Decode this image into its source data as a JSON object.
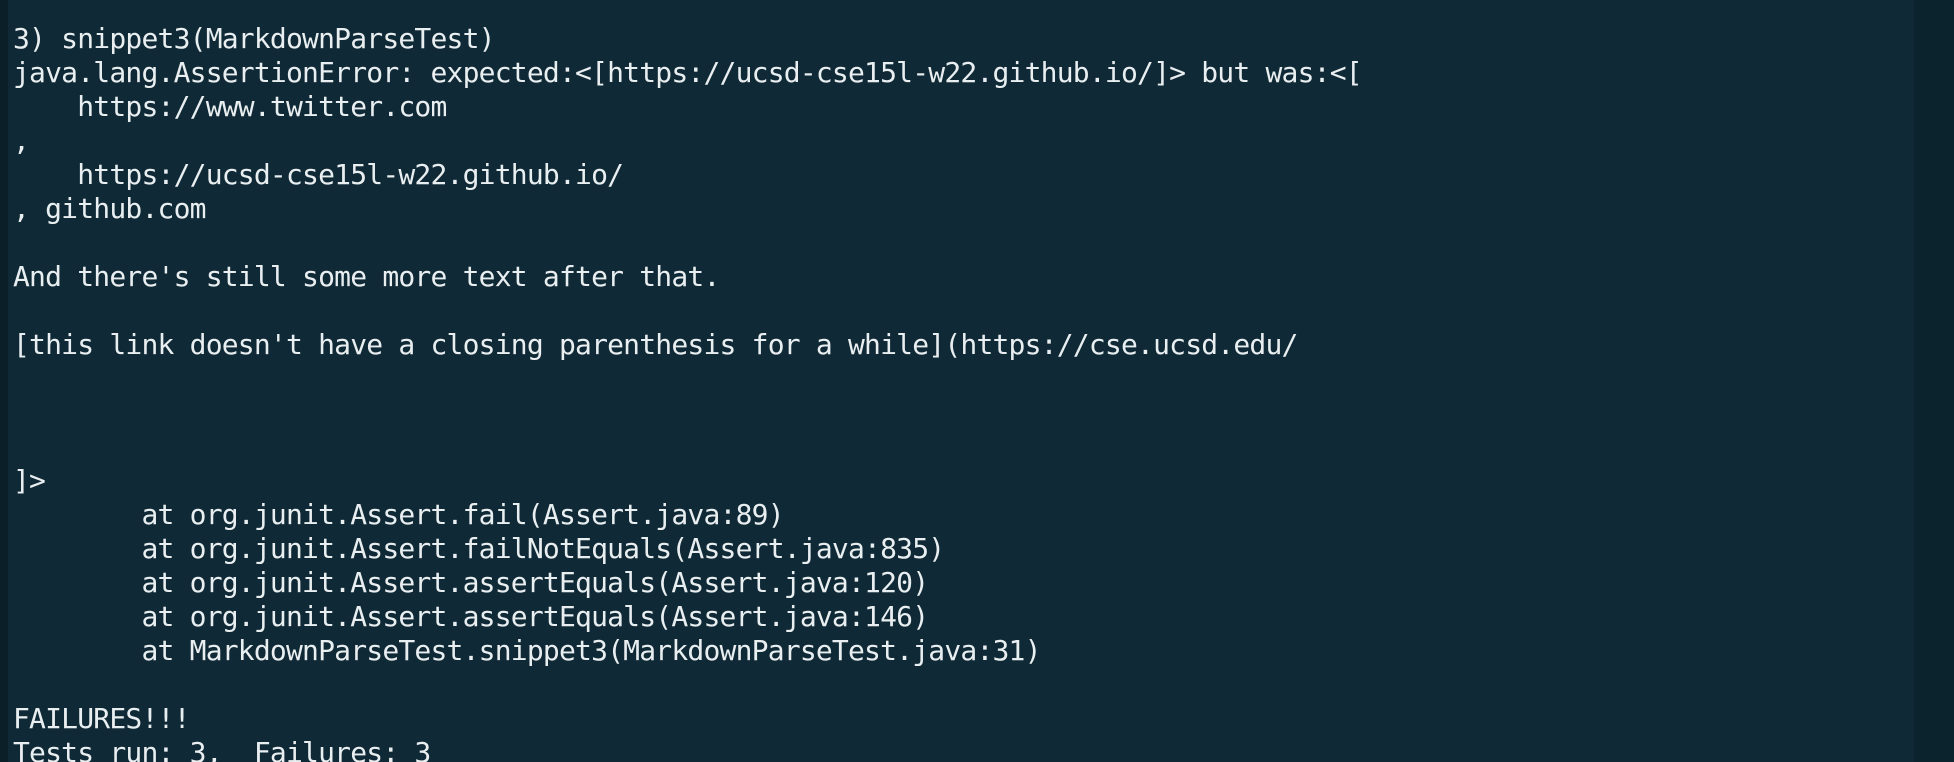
{
  "terminal": {
    "colors": {
      "background": "#0f2a36",
      "text": "#e9eef0"
    },
    "lines": [
      "",
      "3) snippet3(MarkdownParseTest)",
      "java.lang.AssertionError: expected:<[https://ucsd-cse15l-w22.github.io/]> but was:<[",
      "    https://www.twitter.com",
      ",",
      "    https://ucsd-cse15l-w22.github.io/",
      ", github.com",
      "",
      "And there's still some more text after that.",
      "",
      "[this link doesn't have a closing parenthesis for a while](https://cse.ucsd.edu/",
      "",
      "",
      "",
      "]>",
      "        at org.junit.Assert.fail(Assert.java:89)",
      "        at org.junit.Assert.failNotEquals(Assert.java:835)",
      "        at org.junit.Assert.assertEquals(Assert.java:120)",
      "        at org.junit.Assert.assertEquals(Assert.java:146)",
      "        at MarkdownParseTest.snippet3(MarkdownParseTest.java:31)",
      "",
      "FAILURES!!!",
      "Tests run: 3,  Failures: 3"
    ]
  }
}
